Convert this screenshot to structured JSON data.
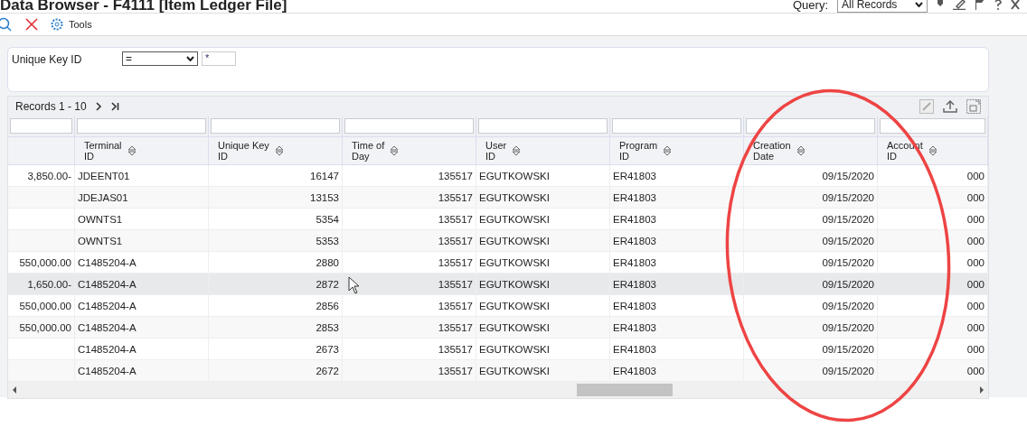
{
  "window": {
    "title": "Data Browser - F4111 [Item Ledger File]"
  },
  "query": {
    "label": "Query:",
    "value": "All Records"
  },
  "toolbar": {
    "tools_label": "Tools"
  },
  "filter": {
    "label": "Unique Key ID",
    "operator": "=",
    "value": "*"
  },
  "pager": {
    "label": "Records 1 - 10"
  },
  "columns": [
    {
      "kind": "number"
    },
    {
      "label": "Terminal\nID",
      "kind": "text"
    },
    {
      "label": "Unique Key\nID",
      "kind": "number"
    },
    {
      "label": "Time of\nDay",
      "kind": "number"
    },
    {
      "label": "User\nID",
      "kind": "text"
    },
    {
      "label": "Program\nID",
      "kind": "text"
    },
    {
      "label": "Creation\nDate",
      "kind": "number"
    },
    {
      "label": "Account\nID",
      "kind": "number"
    }
  ],
  "rows": [
    {
      "selected": false,
      "column_1": "3,850.00-",
      "terminal_id": "JDEENT01",
      "unique_key_id": "16147",
      "time_of_day": "135517",
      "user_id": "EGUTKOWSKI",
      "program_id": "ER41803",
      "creation_date": "09/15/2020",
      "account_id": "000"
    },
    {
      "selected": false,
      "terminal_id": "JDEJAS01",
      "unique_key_id": "13153",
      "time_of_day": "135517",
      "user_id": "EGUTKOWSKI",
      "program_id": "ER41803",
      "creation_date": "09/15/2020",
      "account_id": "000"
    },
    {
      "selected": false,
      "terminal_id": "OWNTS1",
      "unique_key_id": "5354",
      "time_of_day": "135517",
      "user_id": "EGUTKOWSKI",
      "program_id": "ER41803",
      "creation_date": "09/15/2020",
      "account_id": "000"
    },
    {
      "selected": false,
      "terminal_id": "OWNTS1",
      "unique_key_id": "5353",
      "time_of_day": "135517",
      "user_id": "EGUTKOWSKI",
      "program_id": "ER41803",
      "creation_date": "09/15/2020",
      "account_id": "000"
    },
    {
      "selected": false,
      "column_1": "550,000.00",
      "terminal_id": "C1485204-A",
      "unique_key_id": "2880",
      "time_of_day": "135517",
      "user_id": "EGUTKOWSKI",
      "program_id": "ER41803",
      "creation_date": "09/15/2020",
      "account_id": "000"
    },
    {
      "selected": true,
      "column_1": "1,650.00-",
      "terminal_id": "C1485204-A",
      "unique_key_id": "2872",
      "time_of_day": "135517",
      "user_id": "EGUTKOWSKI",
      "program_id": "ER41803",
      "creation_date": "09/15/2020",
      "account_id": "000"
    },
    {
      "selected": false,
      "column_1": "550,000.00",
      "terminal_id": "C1485204-A",
      "unique_key_id": "2856",
      "time_of_day": "135517",
      "user_id": "EGUTKOWSKI",
      "program_id": "ER41803",
      "creation_date": "09/15/2020",
      "account_id": "000"
    },
    {
      "selected": false,
      "column_1": "550,000.00",
      "terminal_id": "C1485204-A",
      "unique_key_id": "2853",
      "time_of_day": "135517",
      "user_id": "EGUTKOWSKI",
      "program_id": "ER41803",
      "creation_date": "09/15/2020",
      "account_id": "000"
    },
    {
      "selected": false,
      "terminal_id": "C1485204-A",
      "unique_key_id": "2673",
      "time_of_day": "135517",
      "user_id": "EGUTKOWSKI",
      "program_id": "ER41803",
      "creation_date": "09/15/2020",
      "account_id": "000"
    },
    {
      "selected": false,
      "terminal_id": "C1485204-A",
      "unique_key_id": "2672",
      "time_of_day": "135517",
      "user_id": "EGUTKOWSKI",
      "program_id": "ER41803",
      "creation_date": "09/15/2020",
      "account_id": "000"
    }
  ]
}
